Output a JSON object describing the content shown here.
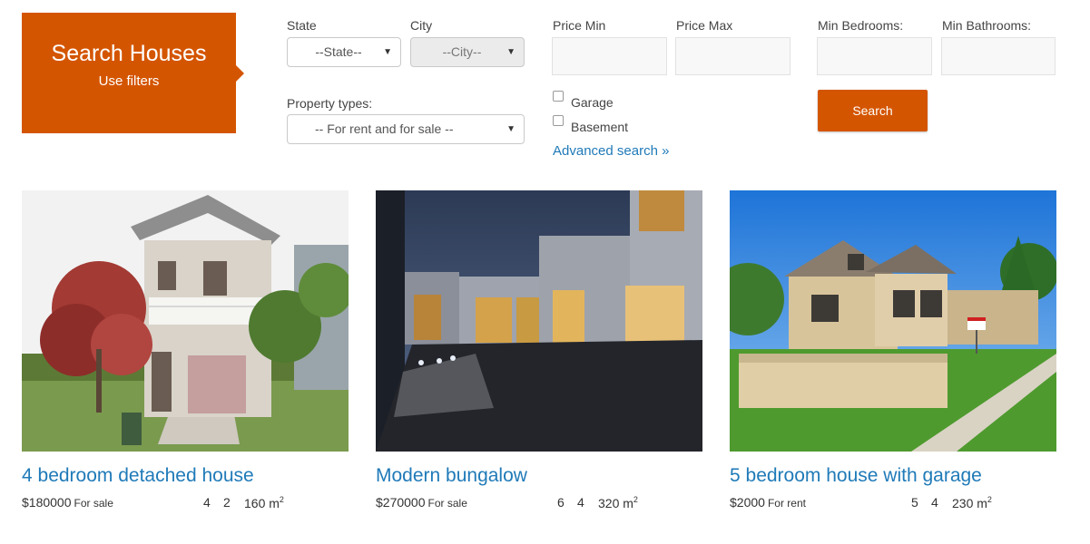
{
  "header": {
    "title": "Search Houses",
    "subtitle": "Use filters",
    "accent_color": "#d45500"
  },
  "filters": {
    "state_label": "State",
    "state_value": "--State--",
    "city_label": "City",
    "city_value": "--City--",
    "property_types_label": "Property types:",
    "property_types_value": "-- For rent and for sale --",
    "price_min_label": "Price Min",
    "price_max_label": "Price Max",
    "garage_label": "Garage",
    "basement_label": "Basement",
    "advanced_search": "Advanced search »",
    "min_bedrooms_label": "Min Bedrooms:",
    "min_bathrooms_label": "Min Bathrooms:",
    "search_button": "Search"
  },
  "listings": [
    {
      "title": "4 bedroom detached house",
      "price": "$180000",
      "status": "For sale",
      "bedrooms": "4",
      "bathrooms": "2",
      "area": "160 m",
      "area_unit_sup": "2"
    },
    {
      "title": "Modern bungalow",
      "price": "$270000",
      "status": "For sale",
      "bedrooms": "6",
      "bathrooms": "4",
      "area": "320 m",
      "area_unit_sup": "2"
    },
    {
      "title": "5 bedroom house with garage",
      "price": "$2000",
      "status": "For rent",
      "bedrooms": "5",
      "bathrooms": "4",
      "area": "230 m",
      "area_unit_sup": "2"
    }
  ],
  "link_color": "#1f7ab8"
}
